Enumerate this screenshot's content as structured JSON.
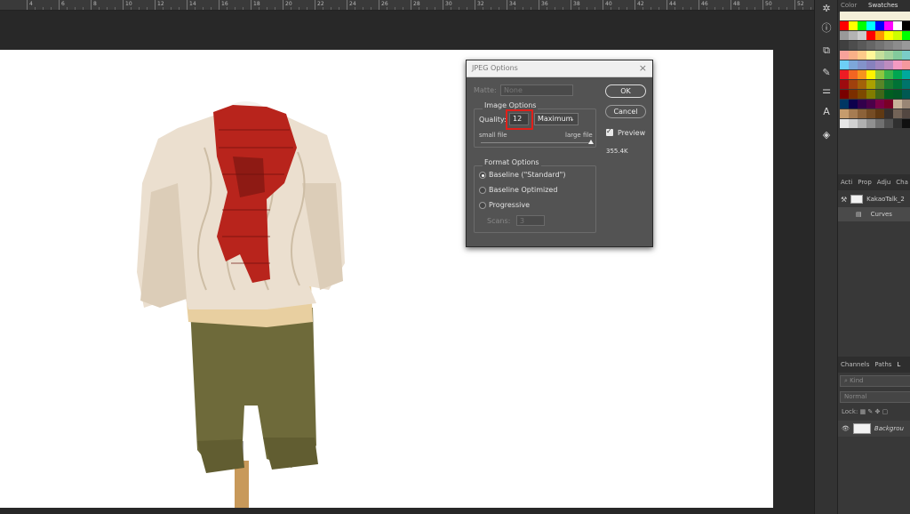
{
  "ruler": {
    "labels": [
      "4",
      "6",
      "8",
      "10",
      "12",
      "14",
      "16",
      "18",
      "20",
      "22",
      "24",
      "26",
      "28",
      "30",
      "32",
      "34",
      "36",
      "38",
      "40",
      "42",
      "44",
      "46",
      "48",
      "50",
      "52"
    ]
  },
  "dialog": {
    "title": "JPEG Options",
    "close_label": "×",
    "matte_label": "Matte:",
    "matte_value": "None",
    "image_options_label": "Image Options",
    "quality_label": "Quality:",
    "quality_value": "12",
    "quality_preset": "Maximum",
    "small_file_label": "small file",
    "large_file_label": "large file",
    "format_options_label": "Format Options",
    "formats": [
      "Baseline (\"Standard\")",
      "Baseline Optimized",
      "Progressive"
    ],
    "selected_format": "Baseline (\"Standard\")",
    "scans_label": "Scans:",
    "scans_value": "3",
    "ok_label": "OK",
    "cancel_label": "Cancel",
    "preview_label": "Preview",
    "preview_checked": true,
    "file_size": "355.4K",
    "quality_slider_fraction": 1.0
  },
  "panels": {
    "top_tabs": [
      "Color",
      "Swatches"
    ],
    "mid_tabs": [
      "Acti",
      "Prop",
      "Adju",
      "Cha"
    ],
    "history_items": [
      "KakaoTalk_2",
      "Curves"
    ],
    "layer_tabs": [
      "Channels",
      "Paths",
      "L"
    ],
    "kind_label": "Kind",
    "blend_mode": "Normal",
    "lock_label": "Lock:",
    "layer_name": "Backgrou"
  },
  "colors": {
    "highlight": "#e0201a",
    "swatches_row1": [
      "#ff0000",
      "#ffff00",
      "#00ff00",
      "#00ffff",
      "#0000ff",
      "#ff00ff",
      "#ffffff",
      "#000000"
    ],
    "swatches_row2": [
      "#999999",
      "#b3b3b3",
      "#cccccc",
      "#ff0000",
      "#ff9900",
      "#ffff00",
      "#ccff00",
      "#00ff00"
    ]
  }
}
